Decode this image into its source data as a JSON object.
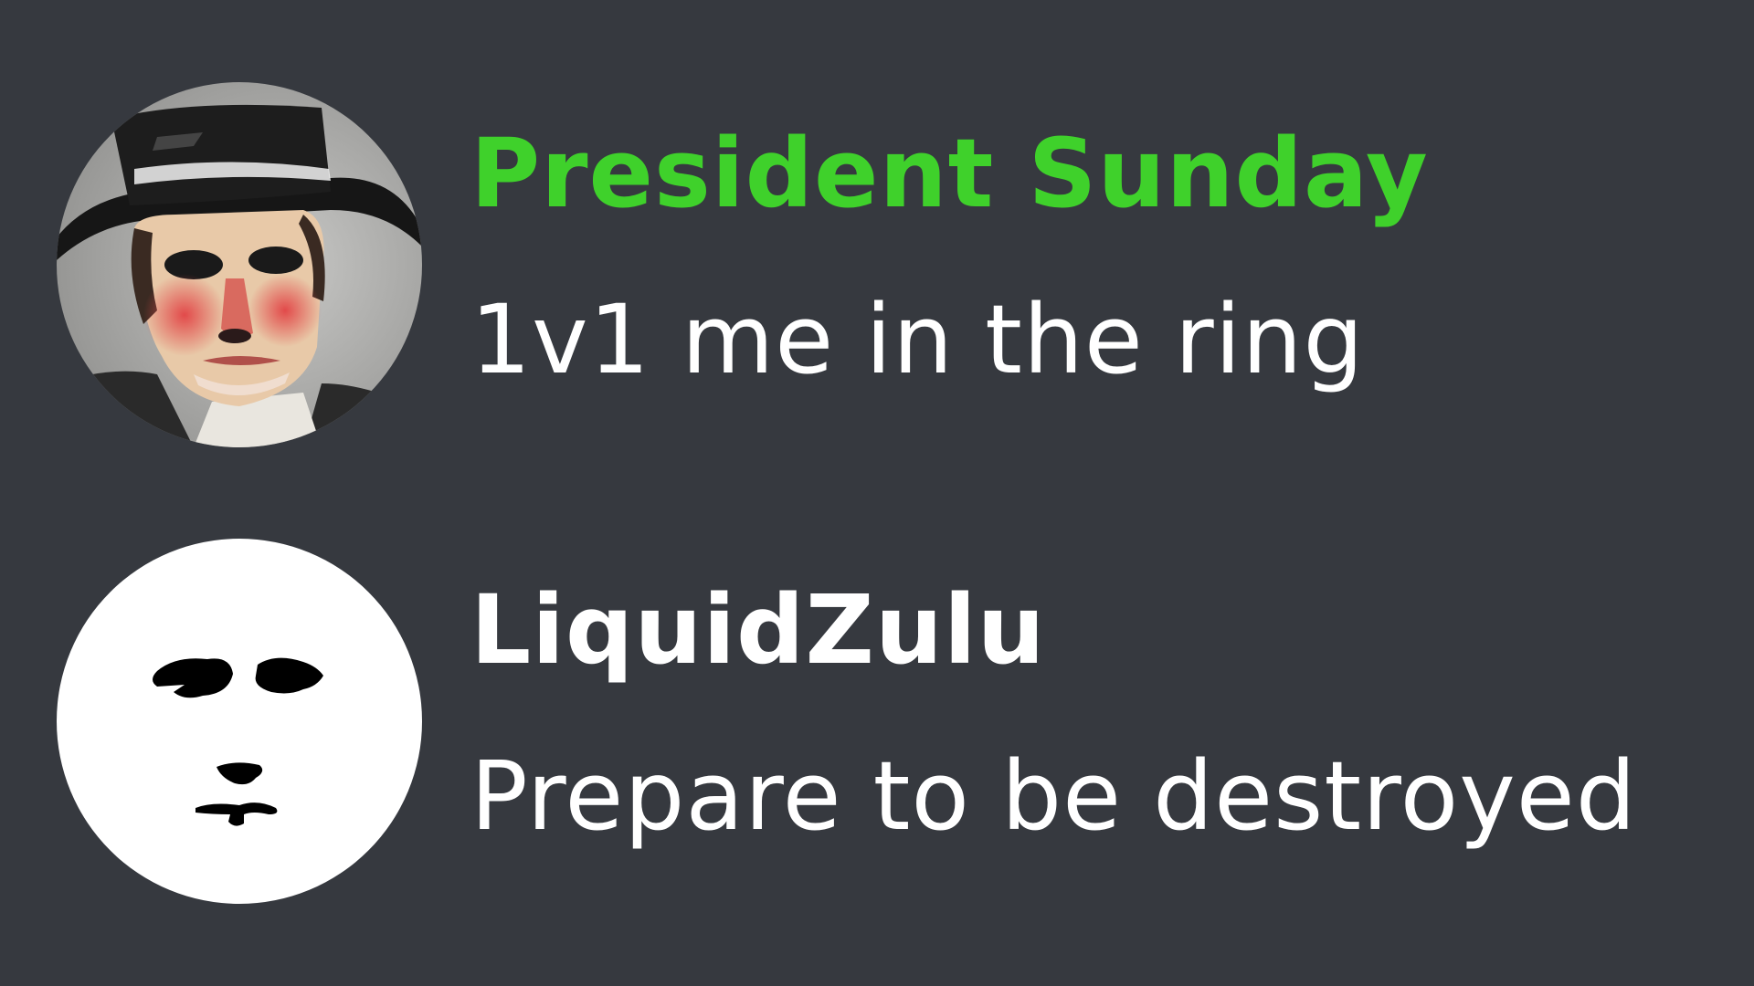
{
  "theme": {
    "background": "#36393f",
    "message_text_color": "#ffffff"
  },
  "messages": [
    {
      "username": "President Sunday",
      "username_color": "#3fd12b",
      "text": "1v1 me in the ring",
      "avatar_icon": "painted-man-in-top-hat-avatar"
    },
    {
      "username": "LiquidZulu",
      "username_color": "#ffffff",
      "text": "Prepare to be destroyed",
      "avatar_icon": "minimal-face-avatar"
    }
  ]
}
